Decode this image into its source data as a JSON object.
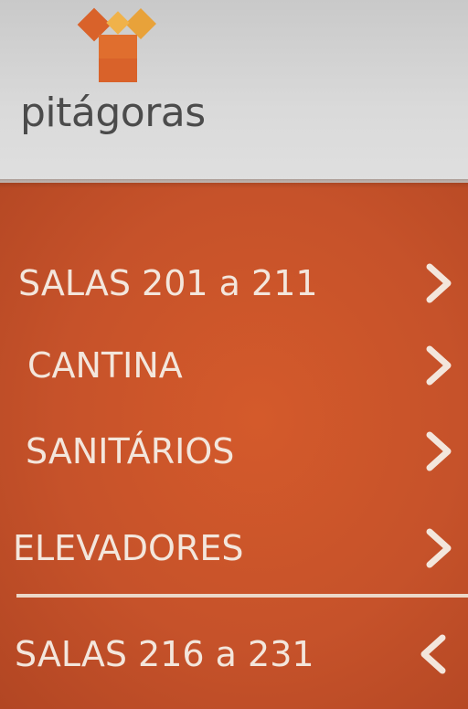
{
  "brand": {
    "name": "pitágoras",
    "colors": {
      "orange": "#d9622a",
      "yellow": "#e8a23a",
      "gold": "#f0b24a",
      "text": "#4b4b4b"
    }
  },
  "panel": {
    "background": "#c95327",
    "text_color": "#f3e6dc"
  },
  "menu": {
    "items": [
      {
        "label": "SALAS 201 a 211",
        "icon": "chevron-right-icon"
      },
      {
        "label": "CANTINA",
        "icon": "chevron-right-icon"
      },
      {
        "label": "SANITÁRIOS",
        "icon": "chevron-right-icon"
      },
      {
        "label": "ELEVADORES",
        "icon": "chevron-right-icon"
      },
      {
        "label": "SALAS 216 a 231",
        "icon": "chevron-left-icon"
      }
    ]
  }
}
